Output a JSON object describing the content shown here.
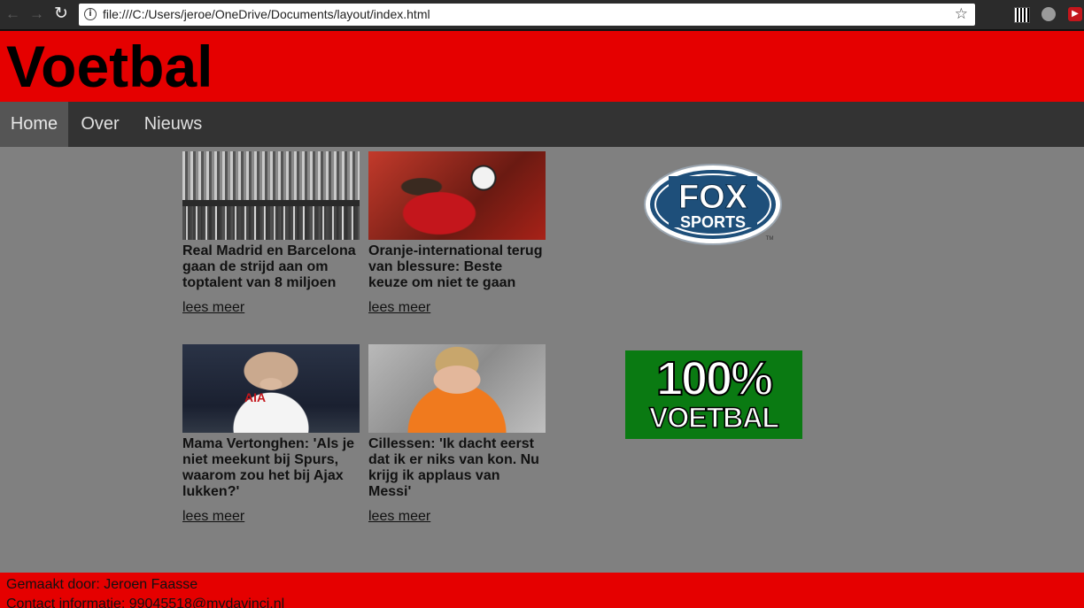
{
  "browser": {
    "url": "file:///C:/Users/jeroe/OneDrive/Documents/layout/index.html"
  },
  "header": {
    "title": "Voetbal"
  },
  "nav": {
    "items": [
      {
        "label": "Home",
        "active": true
      },
      {
        "label": "Over",
        "active": false
      },
      {
        "label": "Nieuws",
        "active": false
      }
    ]
  },
  "articles": [
    {
      "headline": "Real Madrid en Barcelona gaan de strijd aan om toptalent van 8 miljoen",
      "link": "lees meer",
      "image": "stadium-stands-image"
    },
    {
      "headline": "Oranje-international terug van blessure: Beste keuze om niet te gaan",
      "link": "lees meer",
      "image": "player-header-image"
    },
    {
      "headline": "Mama Vertonghen: 'Als je niet meekunt bij Spurs, waarom zou het bij Ajax lukken?'",
      "link": "lees meer",
      "image": "spurs-player-image",
      "shirt_sponsor": "AIA"
    },
    {
      "headline": "Cillessen: 'Ik dacht eerst dat ik er niks van kon. Nu krijg ik applaus van Messi'",
      "link": "lees meer",
      "image": "keeper-portrait-image"
    }
  ],
  "sidebar": {
    "fox_logo": {
      "line1": "FOX",
      "line2": "SPORTS",
      "tm": "TM"
    },
    "voetbal_logo": {
      "line1": "100%",
      "line2": "VOETBAL"
    }
  },
  "footer": {
    "made_by": "Gemaakt door: Jeroen Faasse",
    "contact": "Contact informatie: 99045518@mydavinci.nl"
  },
  "colors": {
    "header_red": "#e50000",
    "nav_dark": "#333333",
    "nav_active": "#555555",
    "page_gray": "#808080",
    "fox_blue": "#1e4f7a",
    "voetbal_green": "#0a7a12"
  }
}
